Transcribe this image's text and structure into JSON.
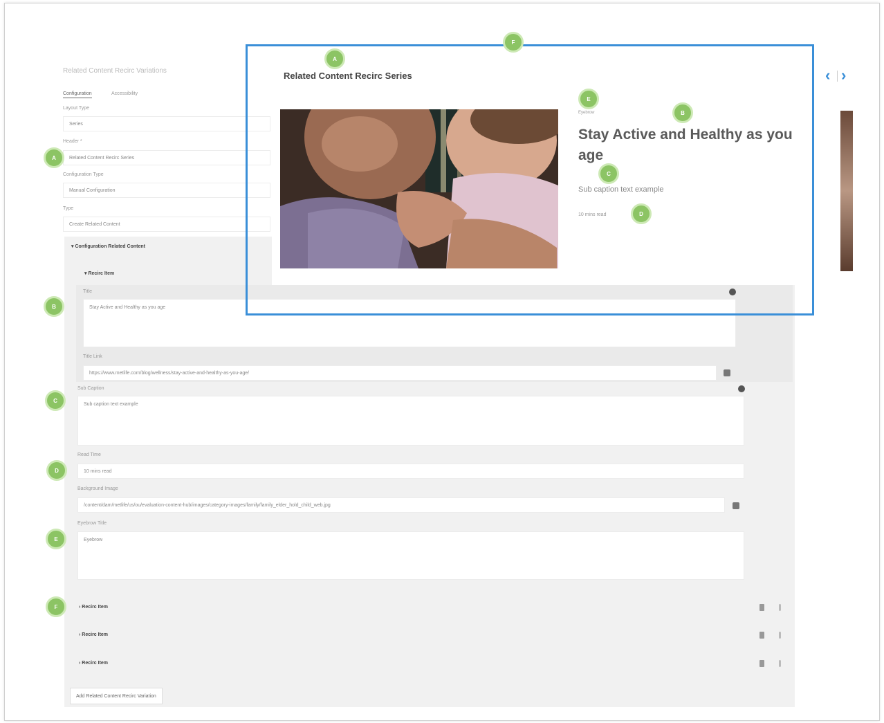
{
  "page": {
    "title": "Related Content Recirc Variations",
    "tabs": [
      "Configuration",
      "Accessibility"
    ]
  },
  "form": {
    "layout_type_label": "Layout Type",
    "layout_type_value": "Series",
    "header_label": "Header *",
    "header_value": "Related Content Recirc Series",
    "config_type_label": "Configuration Type",
    "config_type_value": "Manual Configuration",
    "type_label": "Type",
    "type_value": "Create Related Content",
    "section_title": "Configuration Related Content",
    "item_title": "Recirc Item",
    "title_label": "Title",
    "title_value": "Stay Active and Healthy as you age",
    "title_link_label": "Title Link",
    "title_link_value": "https://www.metlife.com/blog/wellness/stay-active-and-healthy-as-you-age/",
    "subcaption_label": "Sub Caption",
    "subcaption_value": "Sub caption text example",
    "read_time_label": "Read Time",
    "read_time_value": "10 mins read",
    "bg_image_label": "Background Image",
    "bg_image_value": "/content/dam/metlife/us/ou/evaluation-content-hub/images/category-images/family/family_elder_hold_child_web.jpg",
    "eyebrow_label": "Eyebrow Title",
    "eyebrow_value": "Eyebrow",
    "collapsed_items": [
      "Recirc Item",
      "Recirc Item",
      "Recirc Item"
    ],
    "add_button": "Add Related Content Recirc Variation"
  },
  "preview": {
    "header": "Related Content Recirc Series",
    "eyebrow": "Eyebrow",
    "title": "Stay Active and Healthy as you age",
    "subcaption": "Sub caption text example",
    "read_time": "10 mins read",
    "nav_prev": "‹",
    "nav_next": "›"
  },
  "badges": {
    "header": "A",
    "title": "B",
    "subcaption": "C",
    "read_time": "D",
    "eyebrow": "E",
    "items": "F"
  },
  "colors": {
    "accent_blue": "#3a8fd8",
    "badge_green": "#8cc464",
    "section_gray": "#f1f1f1"
  }
}
